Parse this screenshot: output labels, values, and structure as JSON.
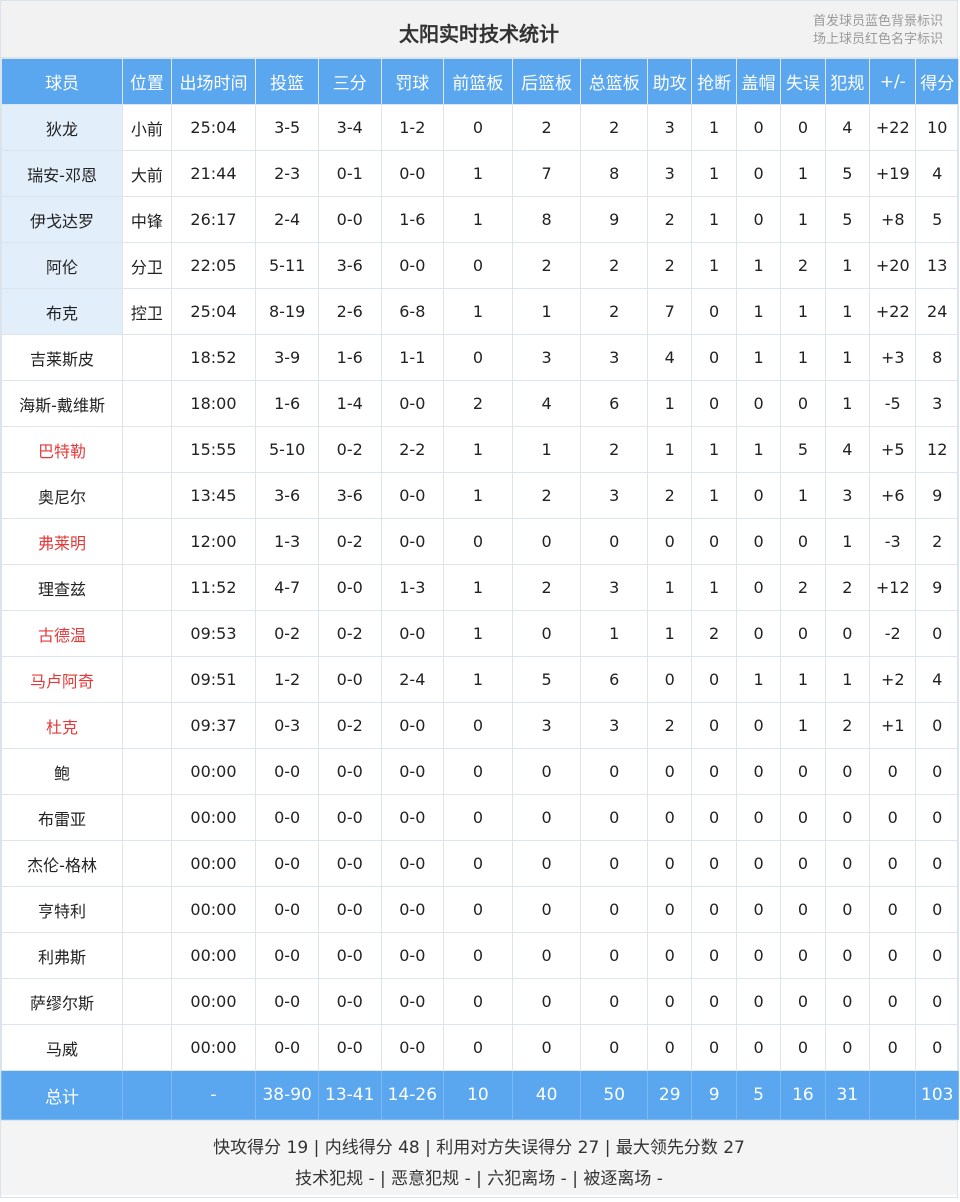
{
  "header": {
    "title": "太阳实时技术统计",
    "legend_line1": "首发球员蓝色背景标识",
    "legend_line2": "场上球员红色名字标识"
  },
  "colors": {
    "header_bg": "#5aa7f0",
    "starter_bg": "#e3eefb",
    "oncourt_text": "#e53a3a"
  },
  "columns": [
    "球员",
    "位置",
    "出场时间",
    "投篮",
    "三分",
    "罚球",
    "前篮板",
    "后篮板",
    "总篮板",
    "助攻",
    "抢断",
    "盖帽",
    "失误",
    "犯规",
    "+/-",
    "得分"
  ],
  "players": [
    {
      "starter": true,
      "oncourt": false,
      "cells": [
        "狄龙",
        "小前",
        "25:04",
        "3-5",
        "3-4",
        "1-2",
        "0",
        "2",
        "2",
        "3",
        "1",
        "0",
        "0",
        "4",
        "+22",
        "10"
      ]
    },
    {
      "starter": true,
      "oncourt": false,
      "cells": [
        "瑞安-邓恩",
        "大前",
        "21:44",
        "2-3",
        "0-1",
        "0-0",
        "1",
        "7",
        "8",
        "3",
        "1",
        "0",
        "1",
        "5",
        "+19",
        "4"
      ]
    },
    {
      "starter": true,
      "oncourt": false,
      "cells": [
        "伊戈达罗",
        "中锋",
        "26:17",
        "2-4",
        "0-0",
        "1-6",
        "1",
        "8",
        "9",
        "2",
        "1",
        "0",
        "1",
        "5",
        "+8",
        "5"
      ]
    },
    {
      "starter": true,
      "oncourt": false,
      "cells": [
        "阿伦",
        "分卫",
        "22:05",
        "5-11",
        "3-6",
        "0-0",
        "0",
        "2",
        "2",
        "2",
        "1",
        "1",
        "2",
        "1",
        "+20",
        "13"
      ]
    },
    {
      "starter": true,
      "oncourt": false,
      "cells": [
        "布克",
        "控卫",
        "25:04",
        "8-19",
        "2-6",
        "6-8",
        "1",
        "1",
        "2",
        "7",
        "0",
        "1",
        "1",
        "1",
        "+22",
        "24"
      ]
    },
    {
      "starter": false,
      "oncourt": false,
      "cells": [
        "吉莱斯皮",
        "",
        "18:52",
        "3-9",
        "1-6",
        "1-1",
        "0",
        "3",
        "3",
        "4",
        "0",
        "1",
        "1",
        "1",
        "+3",
        "8"
      ]
    },
    {
      "starter": false,
      "oncourt": false,
      "cells": [
        "海斯-戴维斯",
        "",
        "18:00",
        "1-6",
        "1-4",
        "0-0",
        "2",
        "4",
        "6",
        "1",
        "0",
        "0",
        "0",
        "1",
        "-5",
        "3"
      ]
    },
    {
      "starter": false,
      "oncourt": true,
      "cells": [
        "巴特勒",
        "",
        "15:55",
        "5-10",
        "0-2",
        "2-2",
        "1",
        "1",
        "2",
        "1",
        "1",
        "1",
        "5",
        "4",
        "+5",
        "12"
      ]
    },
    {
      "starter": false,
      "oncourt": false,
      "cells": [
        "奥尼尔",
        "",
        "13:45",
        "3-6",
        "3-6",
        "0-0",
        "1",
        "2",
        "3",
        "2",
        "1",
        "0",
        "1",
        "3",
        "+6",
        "9"
      ]
    },
    {
      "starter": false,
      "oncourt": true,
      "cells": [
        "弗莱明",
        "",
        "12:00",
        "1-3",
        "0-2",
        "0-0",
        "0",
        "0",
        "0",
        "0",
        "0",
        "0",
        "0",
        "1",
        "-3",
        "2"
      ]
    },
    {
      "starter": false,
      "oncourt": false,
      "cells": [
        "理查兹",
        "",
        "11:52",
        "4-7",
        "0-0",
        "1-3",
        "1",
        "2",
        "3",
        "1",
        "1",
        "0",
        "2",
        "2",
        "+12",
        "9"
      ]
    },
    {
      "starter": false,
      "oncourt": true,
      "cells": [
        "古德温",
        "",
        "09:53",
        "0-2",
        "0-2",
        "0-0",
        "1",
        "0",
        "1",
        "1",
        "2",
        "0",
        "0",
        "0",
        "-2",
        "0"
      ]
    },
    {
      "starter": false,
      "oncourt": true,
      "cells": [
        "马卢阿奇",
        "",
        "09:51",
        "1-2",
        "0-0",
        "2-4",
        "1",
        "5",
        "6",
        "0",
        "0",
        "1",
        "1",
        "1",
        "+2",
        "4"
      ]
    },
    {
      "starter": false,
      "oncourt": true,
      "cells": [
        "杜克",
        "",
        "09:37",
        "0-3",
        "0-2",
        "0-0",
        "0",
        "3",
        "3",
        "2",
        "0",
        "0",
        "1",
        "2",
        "+1",
        "0"
      ]
    },
    {
      "starter": false,
      "oncourt": false,
      "cells": [
        "鲍",
        "",
        "00:00",
        "0-0",
        "0-0",
        "0-0",
        "0",
        "0",
        "0",
        "0",
        "0",
        "0",
        "0",
        "0",
        "0",
        "0"
      ]
    },
    {
      "starter": false,
      "oncourt": false,
      "cells": [
        "布雷亚",
        "",
        "00:00",
        "0-0",
        "0-0",
        "0-0",
        "0",
        "0",
        "0",
        "0",
        "0",
        "0",
        "0",
        "0",
        "0",
        "0"
      ]
    },
    {
      "starter": false,
      "oncourt": false,
      "cells": [
        "杰伦-格林",
        "",
        "00:00",
        "0-0",
        "0-0",
        "0-0",
        "0",
        "0",
        "0",
        "0",
        "0",
        "0",
        "0",
        "0",
        "0",
        "0"
      ]
    },
    {
      "starter": false,
      "oncourt": false,
      "cells": [
        "亨特利",
        "",
        "00:00",
        "0-0",
        "0-0",
        "0-0",
        "0",
        "0",
        "0",
        "0",
        "0",
        "0",
        "0",
        "0",
        "0",
        "0"
      ]
    },
    {
      "starter": false,
      "oncourt": false,
      "cells": [
        "利弗斯",
        "",
        "00:00",
        "0-0",
        "0-0",
        "0-0",
        "0",
        "0",
        "0",
        "0",
        "0",
        "0",
        "0",
        "0",
        "0",
        "0"
      ]
    },
    {
      "starter": false,
      "oncourt": false,
      "cells": [
        "萨缪尔斯",
        "",
        "00:00",
        "0-0",
        "0-0",
        "0-0",
        "0",
        "0",
        "0",
        "0",
        "0",
        "0",
        "0",
        "0",
        "0",
        "0"
      ]
    },
    {
      "starter": false,
      "oncourt": false,
      "cells": [
        "马威",
        "",
        "00:00",
        "0-0",
        "0-0",
        "0-0",
        "0",
        "0",
        "0",
        "0",
        "0",
        "0",
        "0",
        "0",
        "0",
        "0"
      ]
    }
  ],
  "totals": [
    "总计",
    "",
    "-",
    "38-90",
    "13-41",
    "14-26",
    "10",
    "40",
    "50",
    "29",
    "9",
    "5",
    "16",
    "31",
    "",
    "103"
  ],
  "footer": {
    "line1": "快攻得分 19 | 内线得分 48 | 利用对方失误得分 27 | 最大领先分数 27",
    "line2": "技术犯规 - | 恶意犯规 - | 六犯离场 - | 被逐离场 -"
  }
}
